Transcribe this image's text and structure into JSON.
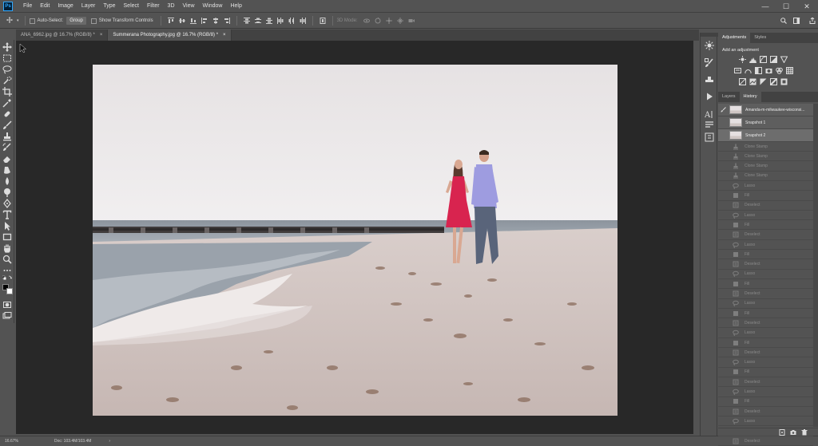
{
  "app": {
    "logo": "Ps"
  },
  "menu": [
    "File",
    "Edit",
    "Image",
    "Layer",
    "Type",
    "Select",
    "Filter",
    "3D",
    "View",
    "Window",
    "Help"
  ],
  "window_controls": {
    "minimize": "—",
    "maximize": "☐",
    "close": "✕"
  },
  "options_bar": {
    "auto_select_label": "Auto-Select:",
    "auto_select_value": "Group",
    "show_transform_label": "Show Transform Controls",
    "mode_3d_label": "3D Mode:"
  },
  "tabs": [
    {
      "label": "ANA_6962.jpg @ 16.7% (RGB/8) *",
      "close": "×"
    },
    {
      "label": "Summerana Photography.jpg @ 16.7% (RGB/8) *",
      "close": "×"
    }
  ],
  "status": {
    "zoom": "16.67%",
    "doc": "Doc: 103.4M/103.4M",
    "arrow": "›"
  },
  "adjustments_panel": {
    "tabs": [
      "Adjustments",
      "Styles"
    ],
    "title": "Add an adjustment"
  },
  "history_panel": {
    "tabs": [
      "Layers",
      "History"
    ],
    "snapshots": [
      "Amanda-m-milwaukee-wisconsi...",
      "Snapshot 1",
      "Snapshot 2"
    ],
    "states": [
      "Clone Stamp",
      "Clone Stamp",
      "Clone Stamp",
      "Clone Stamp",
      "Lasso",
      "Fill",
      "Deselect",
      "Lasso",
      "Fill",
      "Deselect",
      "Lasso",
      "Fill",
      "Deselect",
      "Lasso",
      "Fill",
      "Deselect",
      "Lasso",
      "Fill",
      "Deselect",
      "Lasso",
      "Fill",
      "Deselect",
      "Lasso",
      "Fill",
      "Deselect",
      "Lasso",
      "Fill",
      "Deselect",
      "Lasso",
      "Fill",
      "Deselect"
    ]
  },
  "colors": {
    "ui_bg": "#535353",
    "canvas_bg": "#282828",
    "tab_bg": "#424242",
    "accent": "#31a8ff",
    "dress": "#d8244f",
    "shirt": "#9e9ce0"
  }
}
